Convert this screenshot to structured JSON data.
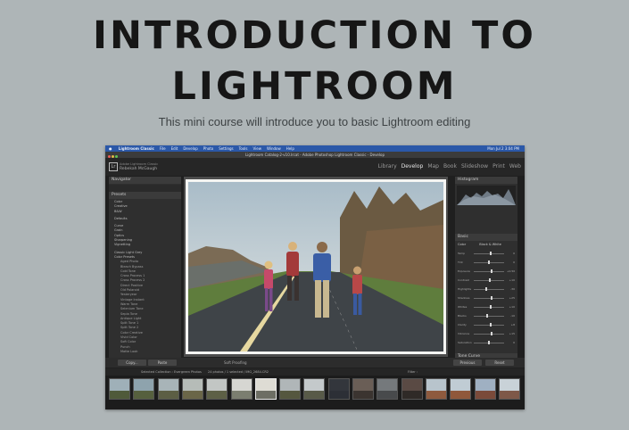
{
  "headline": {
    "line1": "INTRODUCTION TO",
    "line2": "LIGHTROOM",
    "subtitle": "This mini course will introduce you to basic Lightroom editing"
  },
  "menubar": {
    "items": [
      "Lightroom Classic",
      "File",
      "Edit",
      "Develop",
      "Photo",
      "Settings",
      "Tools",
      "View",
      "Window",
      "Help"
    ],
    "clock": "Mon Jul 2  3:04 PM"
  },
  "window": {
    "title": "Lightroom Catalog-2-v10.lrcat - Adobe Photoshop Lightroom Classic - Develop"
  },
  "identity_plate": {
    "logo": "Lr",
    "product": "Adobe Lightroom Classic",
    "owner": "Rebekah McGaugh"
  },
  "modules": {
    "items": [
      "Library",
      "Develop",
      "Map",
      "Book",
      "Slideshow",
      "Print",
      "Web"
    ],
    "active": "Develop"
  },
  "left_panel": {
    "navigator": "Navigator",
    "presets": "Presets",
    "preset_items": [
      {
        "label": "Color",
        "sub": false
      },
      {
        "label": "Creative",
        "sub": false
      },
      {
        "label": "B&W",
        "sub": false
      },
      {
        "label": "Defaults",
        "sub": false,
        "gap": true
      },
      {
        "label": "Curve",
        "sub": false,
        "gap": true
      },
      {
        "label": "Grain",
        "sub": false
      },
      {
        "label": "Optics",
        "sub": false
      },
      {
        "label": "Sharpening",
        "sub": false
      },
      {
        "label": "Vignetting",
        "sub": false
      },
      {
        "label": "Classic Light Grey",
        "sub": false,
        "gap": true
      },
      {
        "label": "Color Presets",
        "sub": false
      },
      {
        "label": "Aged Photo",
        "sub": true
      },
      {
        "label": "Bleach Bypass",
        "sub": true
      },
      {
        "label": "Cold Tone",
        "sub": true
      },
      {
        "label": "Cross Process 1",
        "sub": true
      },
      {
        "label": "Cross Process 2",
        "sub": true
      },
      {
        "label": "Direct Positive",
        "sub": true
      },
      {
        "label": "Old Polaroid",
        "sub": true
      },
      {
        "label": "Yesteryear",
        "sub": true
      },
      {
        "label": "Vintage Instant",
        "sub": true
      },
      {
        "label": "Warm Tone",
        "sub": true
      },
      {
        "label": "Selenium Tone",
        "sub": true
      },
      {
        "label": "Sepia Tone",
        "sub": true
      },
      {
        "label": "Antique Light",
        "sub": true
      },
      {
        "label": "Split Tone 1",
        "sub": true
      },
      {
        "label": "Split Tone 2",
        "sub": true
      },
      {
        "label": "Color Creative",
        "sub": true
      },
      {
        "label": "Vivid Color",
        "sub": true
      },
      {
        "label": "Soft Color",
        "sub": true
      },
      {
        "label": "Punch",
        "sub": true
      },
      {
        "label": "Matte Look",
        "sub": true
      }
    ],
    "copy_button": "Copy...",
    "paste_button": "Paste"
  },
  "right_panel": {
    "histogram": "Histogram",
    "basic": "Basic",
    "tone_curve": "Tone Curve",
    "treatment_color": "Color",
    "treatment_bw": "Black & White",
    "sliders": [
      {
        "label": "Temp",
        "pos": 0.55,
        "value": "0"
      },
      {
        "label": "Tint",
        "pos": 0.5,
        "value": "0"
      },
      {
        "label": "Exposure",
        "pos": 0.58,
        "value": "+0.50"
      },
      {
        "label": "Contrast",
        "pos": 0.52,
        "value": "+10"
      },
      {
        "label": "Highlights",
        "pos": 0.42,
        "value": "-30"
      },
      {
        "label": "Shadows",
        "pos": 0.6,
        "value": "+25"
      },
      {
        "label": "Whites",
        "pos": 0.55,
        "value": "+10"
      },
      {
        "label": "Blacks",
        "pos": 0.45,
        "value": "-10"
      },
      {
        "label": "Clarity",
        "pos": 0.55,
        "value": "+8"
      },
      {
        "label": "Vibrance",
        "pos": 0.58,
        "value": "+15"
      },
      {
        "label": "Saturation",
        "pos": 0.5,
        "value": "0"
      }
    ],
    "previous_button": "Previous",
    "reset_button": "Reset"
  },
  "toolbar": {
    "soft_proofing": "Soft Proofing"
  },
  "filmstrip": {
    "source": "Selected Collection : Evergreen Photos",
    "info": "24 photos / 1 selected / IMG_2684.CR2",
    "filter": "Filter :",
    "thumbnails": [
      {
        "sky": "#9fb0b8",
        "ground": "#4f5a3a"
      },
      {
        "sky": "#8ea3ad",
        "ground": "#56603e"
      },
      {
        "sky": "#a8b4b8",
        "ground": "#5c5e44"
      },
      {
        "sky": "#b6bcb8",
        "ground": "#6a6648"
      },
      {
        "sky": "#c2c6c4",
        "ground": "#5d6046"
      },
      {
        "sky": "#d6d6d2",
        "ground": "#7b7e70"
      },
      {
        "sky": "#dedcd4",
        "ground": "#6d6e64"
      },
      {
        "sky": "#b0b6b8",
        "ground": "#55573f"
      },
      {
        "sky": "#c4c9cb",
        "ground": "#585a48"
      },
      {
        "sky": "#33363c",
        "ground": "#2c2f36"
      },
      {
        "sky": "#6a5e56",
        "ground": "#3b3430"
      },
      {
        "sky": "#75797c",
        "ground": "#484a4c"
      },
      {
        "sky": "#5a4a44",
        "ground": "#2f2a27"
      },
      {
        "sky": "#b8c4cc",
        "ground": "#8e5a3e"
      },
      {
        "sky": "#c0ccd4",
        "ground": "#90583b"
      },
      {
        "sky": "#9fb0c2",
        "ground": "#7a4a3a"
      },
      {
        "sky": "#c9d2d8",
        "ground": "#7e5848"
      }
    ],
    "selected_index": 6
  }
}
